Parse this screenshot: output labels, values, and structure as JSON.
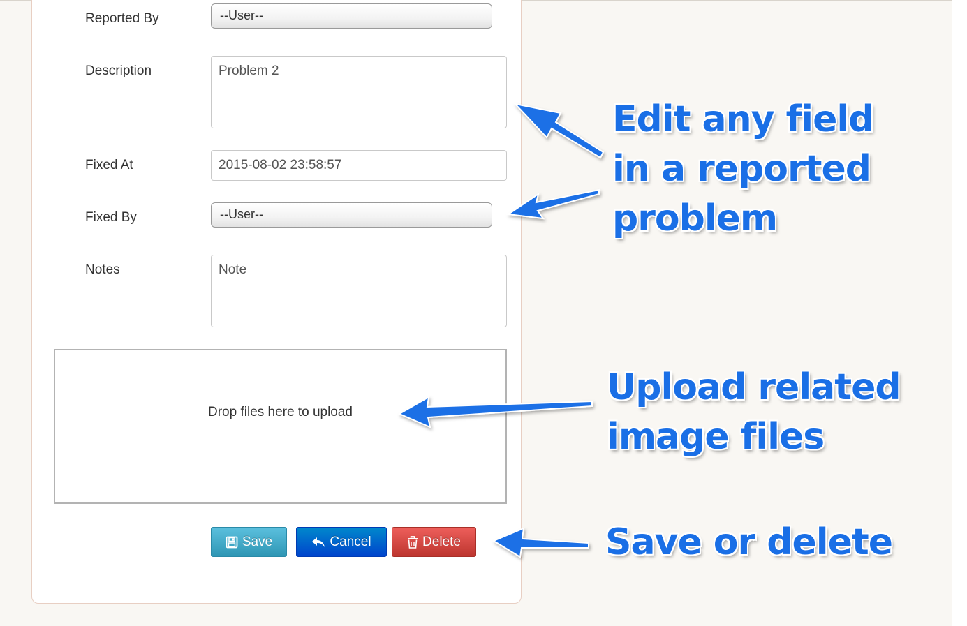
{
  "form": {
    "reported_by_label": "Reported By",
    "reported_by_value": "--User--",
    "description_label": "Description",
    "description_value": "Problem 2",
    "fixed_at_label": "Fixed At",
    "fixed_at_value": "2015-08-02 23:58:57",
    "fixed_by_label": "Fixed By",
    "fixed_by_value": "--User--",
    "notes_label": "Notes",
    "notes_value": "Note"
  },
  "dropzone": {
    "text": "Drop files here to upload"
  },
  "buttons": {
    "save": "Save",
    "cancel": "Cancel",
    "delete": "Delete"
  },
  "callouts": {
    "edit": [
      "Edit any field",
      "in a reported",
      "problem"
    ],
    "upload": [
      "Upload related",
      "image files"
    ],
    "save": [
      "Save or delete"
    ]
  },
  "colors": {
    "callout": "#1a6fe6",
    "save_button": "#5bc0de",
    "cancel_button": "#0055cc",
    "delete_button": "#d9534f"
  },
  "icons": {
    "save": "floppy-disk-icon",
    "cancel": "reply-arrow-icon",
    "delete": "trash-icon"
  }
}
